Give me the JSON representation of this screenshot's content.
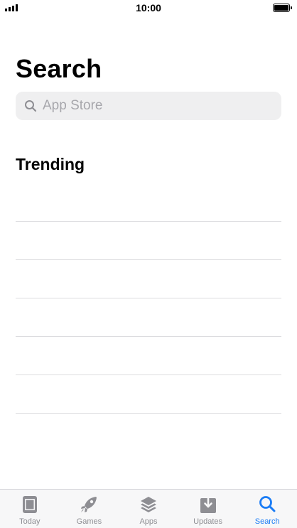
{
  "status_bar": {
    "time": "10:00",
    "battery_level": 1.0
  },
  "header": {
    "title": "Search"
  },
  "search": {
    "placeholder": "App Store",
    "value": ""
  },
  "trending": {
    "title": "Trending",
    "items": [
      "",
      "",
      "",
      "",
      "",
      "",
      ""
    ]
  },
  "tab_bar": {
    "active_tab": "Search",
    "tabs": [
      {
        "label": "Today",
        "icon": "today-icon"
      },
      {
        "label": "Games",
        "icon": "rocket-icon"
      },
      {
        "label": "Apps",
        "icon": "layers-icon"
      },
      {
        "label": "Updates",
        "icon": "download-icon"
      },
      {
        "label": "Search",
        "icon": "search-icon"
      }
    ]
  },
  "colors": {
    "accent": "#1a7cf5",
    "inactive": "#8e8e93",
    "search_bg": "#efeff0"
  }
}
